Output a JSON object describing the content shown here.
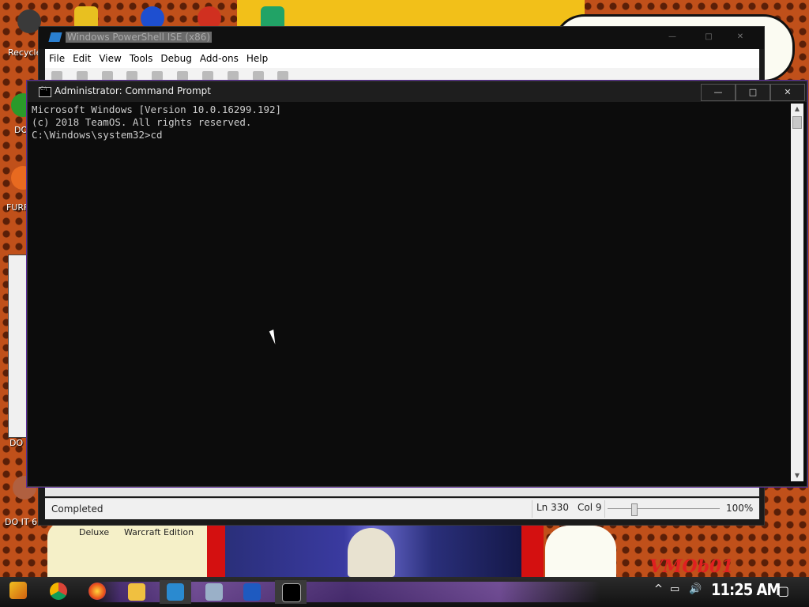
{
  "desktop": {
    "icons": [
      {
        "label": "Recycle"
      },
      {
        "label": "DO"
      },
      {
        "label": "FURF"
      },
      {
        "label": "DO I"
      },
      {
        "label": "DO IT 6"
      }
    ],
    "bottom_labels": [
      "Deluxe",
      "Warcraft Edition"
    ],
    "watermark": "VMOb01"
  },
  "ise": {
    "title": "Windows PowerShell ISE (x86)",
    "menu": [
      "File",
      "Edit",
      "View",
      "Tools",
      "Debug",
      "Add-ons",
      "Help"
    ],
    "status": "Completed",
    "ln": "Ln 330",
    "col": "Col 9",
    "zoom": "100%"
  },
  "cmd": {
    "title": "Administrator: Command Prompt",
    "lines": [
      "Microsoft Windows [Version 10.0.16299.192]",
      "(c) 2018 TeamOS. All rights reserved.",
      "",
      "C:\\Windows\\system32>cd"
    ],
    "controls": {
      "minimize": "—",
      "maximize": "□",
      "close": "✕"
    }
  },
  "taskbar": {
    "apps": [
      "start-icon",
      "chrome-icon",
      "firefox-icon",
      "file-explorer-icon",
      "powershell-ise-icon",
      "task-manager-icon",
      "powershell-icon",
      "command-prompt-icon"
    ],
    "tray": {
      "chevron": "^",
      "clock": "11:25 AM"
    }
  }
}
